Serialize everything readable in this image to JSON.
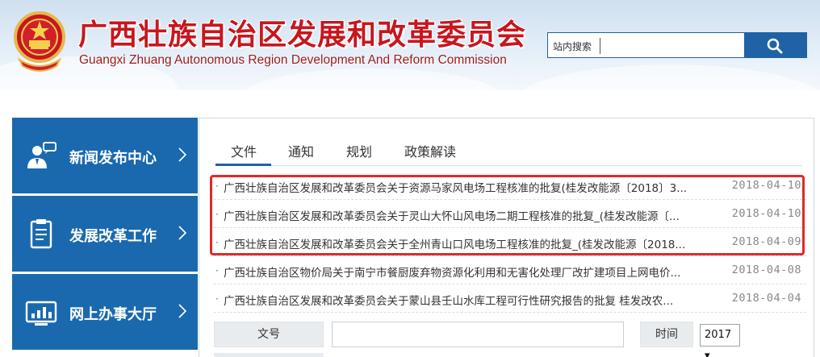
{
  "header": {
    "title": "广西壮族自治区发展和改革委员会",
    "subtitle": "Guangxi Zhuang Autonomous Region Development And Reform Commission",
    "emblem_icon": "national-emblem-icon"
  },
  "search": {
    "label": "站内搜索",
    "placeholder": "",
    "button_icon": "search-icon"
  },
  "sidebar": {
    "items": [
      {
        "label": "新闻发布中心",
        "icon": "spokesperson-icon"
      },
      {
        "label": "发展改革工作",
        "icon": "clipboard-icon"
      },
      {
        "label": "网上办事大厅",
        "icon": "monitor-chart-icon"
      }
    ]
  },
  "tabs": [
    {
      "label": "文件",
      "active": true
    },
    {
      "label": "通知",
      "active": false
    },
    {
      "label": "规划",
      "active": false
    },
    {
      "label": "政策解读",
      "active": false
    }
  ],
  "articles": [
    {
      "title": "广西壮族自治区发展和改革委员会关于资源马家风电场工程核准的批复(桂发改能源〔2018〕3...",
      "date": "2018-04-10"
    },
    {
      "title": "广西壮族自治区发展和改革委员会关于灵山大怀山风电场二期工程核准的批复_(桂发改能源〔...",
      "date": "2018-04-10"
    },
    {
      "title": "广西壮族自治区发展和改革委员会关于全州青山口风电场工程核准的批复_(桂发改能源〔2018...",
      "date": "2018-04-09"
    },
    {
      "title": "广西壮族自治区物价局关于南宁市餐厨废弃物资源化利用和无害化处理厂改扩建项目上网电价...",
      "date": "2018-04-08"
    },
    {
      "title": "广西壮族自治区发展和改革委员会关于蒙山县壬山水库工程可行性研究报告的批复 桂发改农...",
      "date": "2018-04-04"
    }
  ],
  "filter": {
    "doc_no_label": "文号",
    "doc_no_value": "",
    "time_label": "时间",
    "year_value": "2017 ▾"
  },
  "colors": {
    "brand_red": "#c8161d",
    "brand_blue": "#1a69ae",
    "highlight_red": "#e02a2a"
  }
}
